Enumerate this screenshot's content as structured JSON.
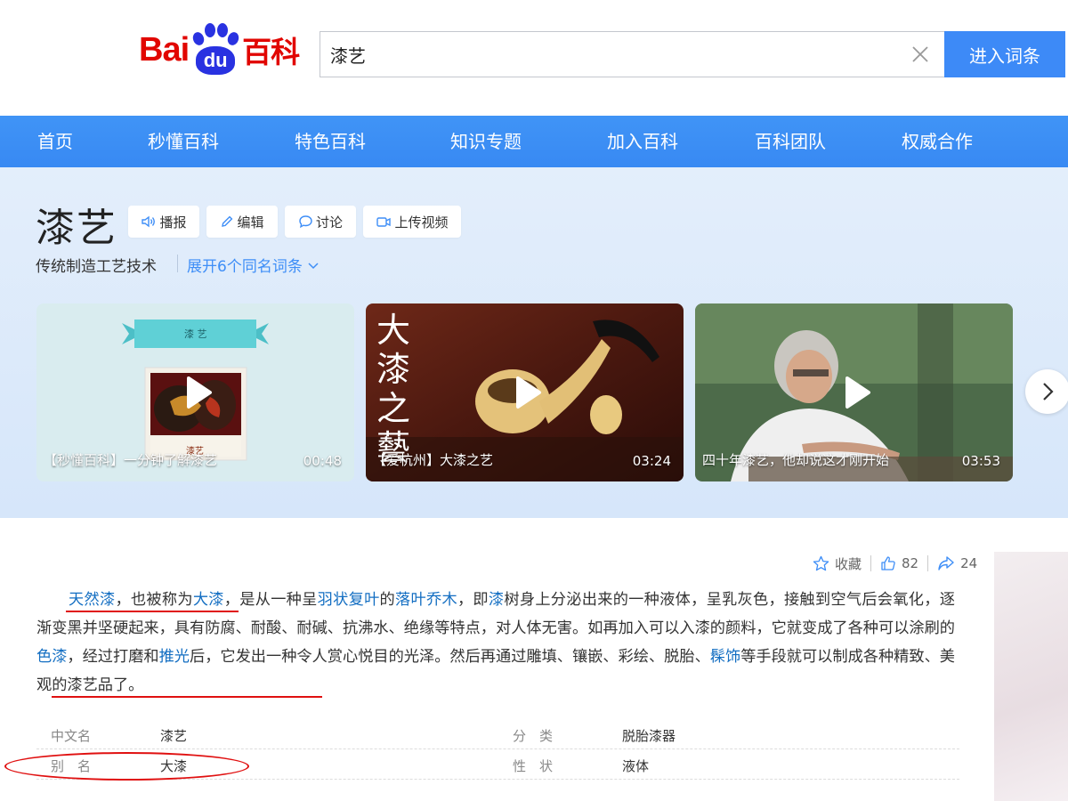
{
  "header": {
    "logo_bai": "Bai",
    "logo_du": "du",
    "logo_baike": "百科",
    "search_value": "漆艺",
    "search_button": "进入词条"
  },
  "nav": [
    "首页",
    "秒懂百科",
    "特色百科",
    "知识专题",
    "加入百科",
    "百科团队",
    "权威合作"
  ],
  "entry": {
    "title": "漆艺",
    "actions": [
      "播报",
      "编辑",
      "讨论",
      "上传视频"
    ],
    "subtitle": "传统制造工艺技术",
    "expand": "展开6个同名词条"
  },
  "videos": [
    {
      "caption": "【秒懂百科】一分钟了解漆艺",
      "duration": "00:48",
      "badge": "漆 艺",
      "sign": "漆艺"
    },
    {
      "caption": "【爱杭州】大漆之艺",
      "duration": "03:24",
      "calligraphy": "大漆之藝"
    },
    {
      "caption": "四十年漆艺，他却说这才刚开始",
      "duration": "03:53"
    }
  ],
  "toolbar": {
    "collect": "收藏",
    "likes": "82",
    "shares": "24"
  },
  "summary": {
    "s1": "天然漆",
    "s2": "，也被称为",
    "s3": "大漆",
    "s4": "，是从一种呈",
    "s5": "羽状复叶",
    "s6": "的",
    "s7": "落叶乔木",
    "s8": "，即",
    "s9": "漆",
    "s10": "树身上分泌出来的一种液体，呈乳灰色，接触到空气后会氧化，逐渐变黑并坚硬起来，具有防腐、耐酸、耐碱、抗沸水、绝缘等特点，对人体无害。如再加入可以入漆的颜料，它就变成了各种可以涂刷的",
    "s11": "色漆",
    "s12": "，经过打磨和",
    "s13": "推光",
    "s14": "后，它发出一种令人赏心悦目的光泽。然后再通过雕填、镶嵌、彩绘、脱胎、",
    "s15": "髹饰",
    "s16": "等手段就可以制成各种精致、美观的漆艺品了。"
  },
  "info": [
    {
      "label1": "中文名",
      "value1": "漆艺",
      "label2": "分　类",
      "value2": "脱胎漆器"
    },
    {
      "label1": "别　名",
      "value1": "大漆",
      "label2": "性　状",
      "value2": "液体"
    }
  ],
  "colors": {
    "brand_red": "#e10601",
    "brand_blue": "#2932e1",
    "nav_blue": "#3e8ef7",
    "link_blue": "#136ec2",
    "annotation_red": "#e01010"
  }
}
